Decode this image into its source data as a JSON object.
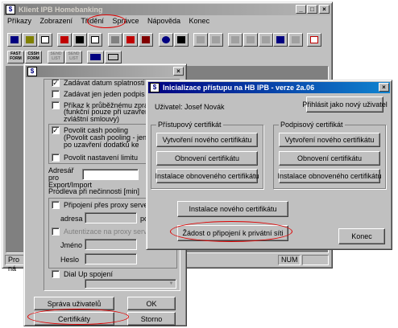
{
  "main": {
    "title": "Klient IPB Homebanking",
    "menu": [
      "Příkazy",
      "Zobrazení",
      "Třídění",
      "Správce",
      "Nápověda",
      "Konec"
    ],
    "toolbar2": [
      "FAST FORM",
      "CSSH FORM",
      "SEND LIST",
      "SEND LIST"
    ],
    "status_left": "Pro ná",
    "status_num": "NUM"
  },
  "settings": {
    "options": [
      {
        "label": "Zadávat datum splatnosti",
        "checked": true
      },
      {
        "label": "Zadávat jen jeden podpis",
        "checked": false
      },
      {
        "label": "Příkaz k průběžnému zpracová",
        "checked": false,
        "note": "(funkční pouze při uzavření zvláštní smlouvy)"
      }
    ],
    "cash_pooling": {
      "label": "Povolit cash pooling",
      "checked": true,
      "note": "(Povolit cash pooling - jen po uzavření dodatků ke smlouvě -"
    },
    "limit": {
      "label": "Povolit nastavení limitu",
      "checked": false
    },
    "export_dir_label": "Adresář pro Export/Import",
    "inactivity_label": "Prodleva při nečinnosti [min]",
    "proxy": {
      "label": "Připojení přes proxy server",
      "checked": false
    },
    "address_label": "adresa",
    "port_label": "po",
    "auth_label": "Autentizace na proxy server",
    "name_label": "Jméno",
    "password_label": "Heslo",
    "dialup": {
      "label": "Dial Up spojení",
      "checked": false
    },
    "buttons": {
      "users": "Správa uživatelů",
      "ok": "OK",
      "certs": "Certifikáty",
      "cancel": "Storno"
    }
  },
  "dialog": {
    "title": "Inicializace přístupu na HB IPB - verze 2a.06",
    "user_label": "Uživatel: Josef Novák",
    "login_other": "Přihlásit jako nový uživatel",
    "access_group": "Přístupový certifikát",
    "signing_group": "Podpisový certifikát",
    "access_buttons": [
      "Vytvoření nového certifikátu",
      "Obnovení certifikátu",
      "Instalace obnoveného certifikátu"
    ],
    "signing_buttons": [
      "Vytvoření nového certifikátu",
      "Obnovení certifikátu",
      "Instalace obnoveného certifikátu"
    ],
    "install_new": "Instalace nového certifikátu",
    "request_connect": "Žádost o připojení k privátní síti",
    "end": "Konec"
  },
  "colors": {
    "highlight": "#e00000",
    "titlebar": "#000080"
  }
}
